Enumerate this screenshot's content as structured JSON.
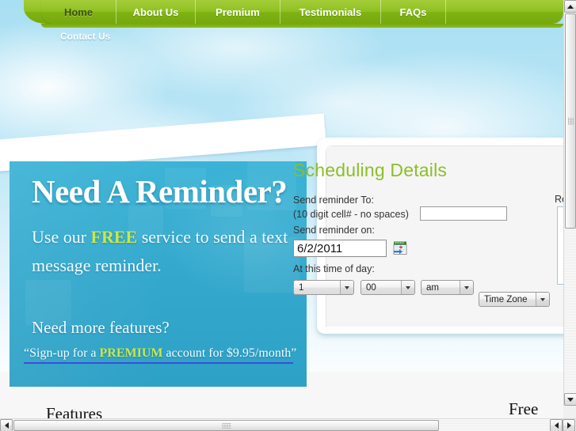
{
  "nav": {
    "primary": [
      {
        "label": "Home",
        "active": true
      },
      {
        "label": "About Us",
        "active": false
      },
      {
        "label": "Premium",
        "active": false
      },
      {
        "label": "Testimonials",
        "active": false
      },
      {
        "label": "FAQs",
        "active": false
      }
    ],
    "secondary": {
      "label": "Contact Us"
    }
  },
  "hero": {
    "title": "Need A Reminder?",
    "sub_before": "Use our ",
    "sub_highlight": "FREE",
    "sub_after": " service to send a text message reminder.",
    "question": "Need more features?",
    "link_before": "“Sign-up for a ",
    "link_highlight": "PREMIUM",
    "link_after": " account for $9.95/month”"
  },
  "form": {
    "title": "Scheduling Details",
    "send_to_label": "Send reminder To:",
    "send_to_hint": "(10 digit cell# - no spaces)",
    "phone_value": "",
    "send_on_label": "Send reminder on:",
    "date_value": "6/2/2011",
    "calendar_icon": "calendar-picker-icon",
    "time_label": "At this time of day:",
    "hour_value": "1",
    "minute_value": "00",
    "meridiem_value": "am",
    "timezone_value": "Time Zone",
    "reminder_label": "Re",
    "reminder_text": ""
  },
  "bottom": {
    "features_heading": "Features",
    "free_heading": "Free"
  },
  "colors": {
    "nav_green": "#8fc122",
    "heading_green": "#8cbf26",
    "hero_blue": "#34a9cd",
    "accent_yellow": "#c9e84a",
    "link_underline": "#3b4ed8"
  },
  "scrollbars": {
    "vertical": {
      "up": "scroll-up-arrow",
      "down": "scroll-down-arrow"
    },
    "horizontal": {
      "left": "scroll-left-arrow",
      "right": "scroll-right-arrow"
    }
  }
}
